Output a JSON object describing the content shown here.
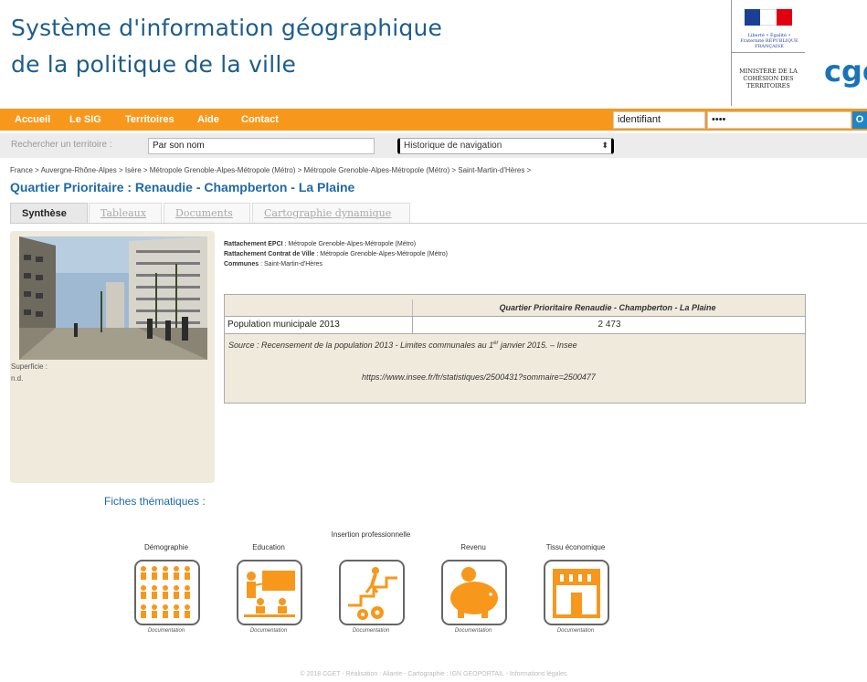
{
  "header": {
    "title_line1": "Système d'information géographique",
    "title_line2": "de la politique de la ville",
    "marianne_text": "Liberté • Égalité • Fraternité RÉPUBLIQUE FRANÇAISE",
    "ministere_text": "MINISTÈRE DE LA COHÉSION DES TERRITOIRES",
    "cget_logo": "cge"
  },
  "nav": {
    "items": [
      "Accueil",
      "Le SIG",
      "Territoires",
      "Aide",
      "Contact"
    ],
    "login_placeholder": "identifiant",
    "password_value": "••••",
    "ok_label": "O"
  },
  "search": {
    "label": "Rechercher un territoire :",
    "input_value": "Par son nom",
    "history_label": "Historique de navigation"
  },
  "breadcrumb": "France > Auvergne-Rhône-Alpes > Isère > Métropole Grenoble-Alpes-Métropole (Métro) > Métropole Grenoble-Alpes-Métropole (Métro) > Saint-Martin-d'Hères >",
  "page_title": "Quartier Prioritaire : Renaudie - Champberton - La Plaine",
  "tabs": [
    "Synthèse",
    "Tableaux",
    "Documents",
    "Cartographie dynamique"
  ],
  "side": {
    "superficie_label": "Superficie :",
    "superficie_value": "n.d."
  },
  "info": {
    "epci_label": "Rattachement EPCI",
    "epci_value": " : Métropole Grenoble-Alpes-Métropole (Métro)",
    "contrat_label": "Rattachement Contrat de Ville",
    "contrat_value": " : Métropole Grenoble-Alpes-Métropole (Métro)",
    "communes_label": "Communes",
    "communes_value": " : Saint-Martin-d'Hères"
  },
  "table": {
    "header": "Quartier Prioritaire Renaudie - Champberton - La Plaine",
    "row_label": "Population municipale 2013",
    "row_value": "2 473",
    "source_pre": "Source : Recensement de la population 2013 - Limites communales au 1",
    "source_sup": "er",
    "source_post": " janvier 2015. – Insee",
    "url": "https://www.insee.fr/fr/statistiques/2500431?sommaire=2500477"
  },
  "fiches": {
    "title": "Fiches thématiques :",
    "items": [
      {
        "name": "Démographie",
        "icon": "population-icon",
        "doc": "Documentation"
      },
      {
        "name": "Education",
        "icon": "classroom-icon",
        "doc": "Documentation"
      },
      {
        "name": "Insertion professionnelle",
        "icon": "career-icon",
        "doc": "Documentation"
      },
      {
        "name": "Revenu",
        "icon": "piggy-bank-icon",
        "doc": "Documentation"
      },
      {
        "name": "Tissu économique",
        "icon": "shop-icon",
        "doc": "Documentation"
      }
    ]
  },
  "colors": {
    "orange": "#f7981d",
    "blue": "#1d6aa5",
    "beige": "#efeadc"
  },
  "footer": "© 2018 CGET - Réalisation : Aliante - Cartographie : IGN GEOPORTAIL - Informations légales"
}
